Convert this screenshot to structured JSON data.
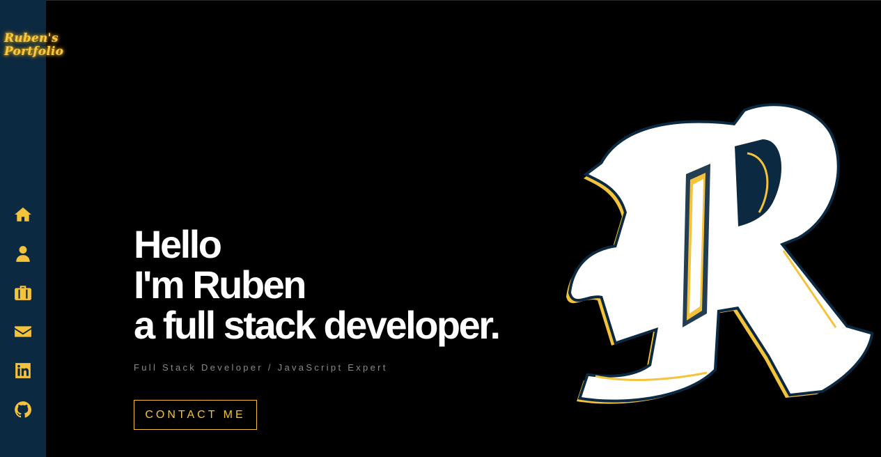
{
  "logo": {
    "line1": "Ruben's",
    "line2": "Portfolio"
  },
  "nav": [
    {
      "icon": "home-icon",
      "label": "Home"
    },
    {
      "icon": "user-icon",
      "label": "About"
    },
    {
      "icon": "briefcase-icon",
      "label": "Work"
    },
    {
      "icon": "envelope-icon",
      "label": "Contact"
    },
    {
      "icon": "linkedin-icon",
      "label": "LinkedIn"
    },
    {
      "icon": "github-icon",
      "label": "GitHub"
    }
  ],
  "hero": {
    "line1": "Hello",
    "line2": "I'm Ruben",
    "line3": "a full stack developer."
  },
  "subtitle": "Full Stack Developer / JavaScript Expert",
  "cta_label": "CONTACT ME",
  "colors": {
    "accent": "#f5c33b",
    "sidebar": "#0b2940",
    "background": "#000000",
    "text": "#ffffff",
    "subtitle": "#8a8a8a"
  }
}
